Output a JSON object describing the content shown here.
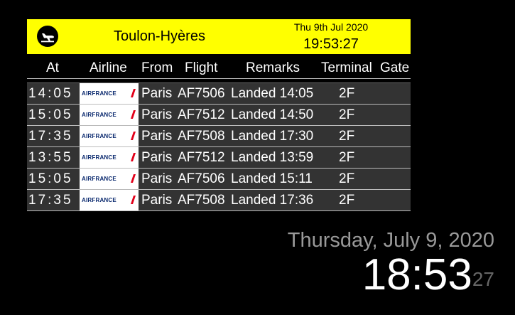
{
  "board": {
    "airport": "Toulon-Hyères",
    "date": "Thu 9th Jul 2020",
    "time": "19:53:27",
    "icon": "plane-arrival-icon",
    "accent": "#ffff00"
  },
  "columns": {
    "at": "At",
    "airline": "Airline",
    "from": "From",
    "flight": "Flight",
    "remarks": "Remarks",
    "terminal": "Terminal",
    "gate": "Gate"
  },
  "flights": [
    {
      "at": "14:05",
      "airline": "AIRFRANCE",
      "from": "Paris",
      "flight": "AF7506",
      "remarks": "Landed 14:05",
      "gate": "2F"
    },
    {
      "at": "15:05",
      "airline": "AIRFRANCE",
      "from": "Paris",
      "flight": "AF7512",
      "remarks": "Landed 14:50",
      "gate": "2F"
    },
    {
      "at": "17:35",
      "airline": "AIRFRANCE",
      "from": "Paris",
      "flight": "AF7508",
      "remarks": "Landed 17:30",
      "gate": "2F"
    },
    {
      "at": "13:55",
      "airline": "AIRFRANCE",
      "from": "Paris",
      "flight": "AF7512",
      "remarks": "Landed 13:59",
      "gate": "2F"
    },
    {
      "at": "15:05",
      "airline": "AIRFRANCE",
      "from": "Paris",
      "flight": "AF7506",
      "remarks": "Landed 15:11",
      "gate": "2F"
    },
    {
      "at": "17:35",
      "airline": "AIRFRANCE",
      "from": "Paris",
      "flight": "AF7508",
      "remarks": "Landed 17:36",
      "gate": "2F"
    }
  ],
  "clock": {
    "date": "Thursday, July 9, 2020",
    "hm": "18:53",
    "seconds": "27"
  }
}
